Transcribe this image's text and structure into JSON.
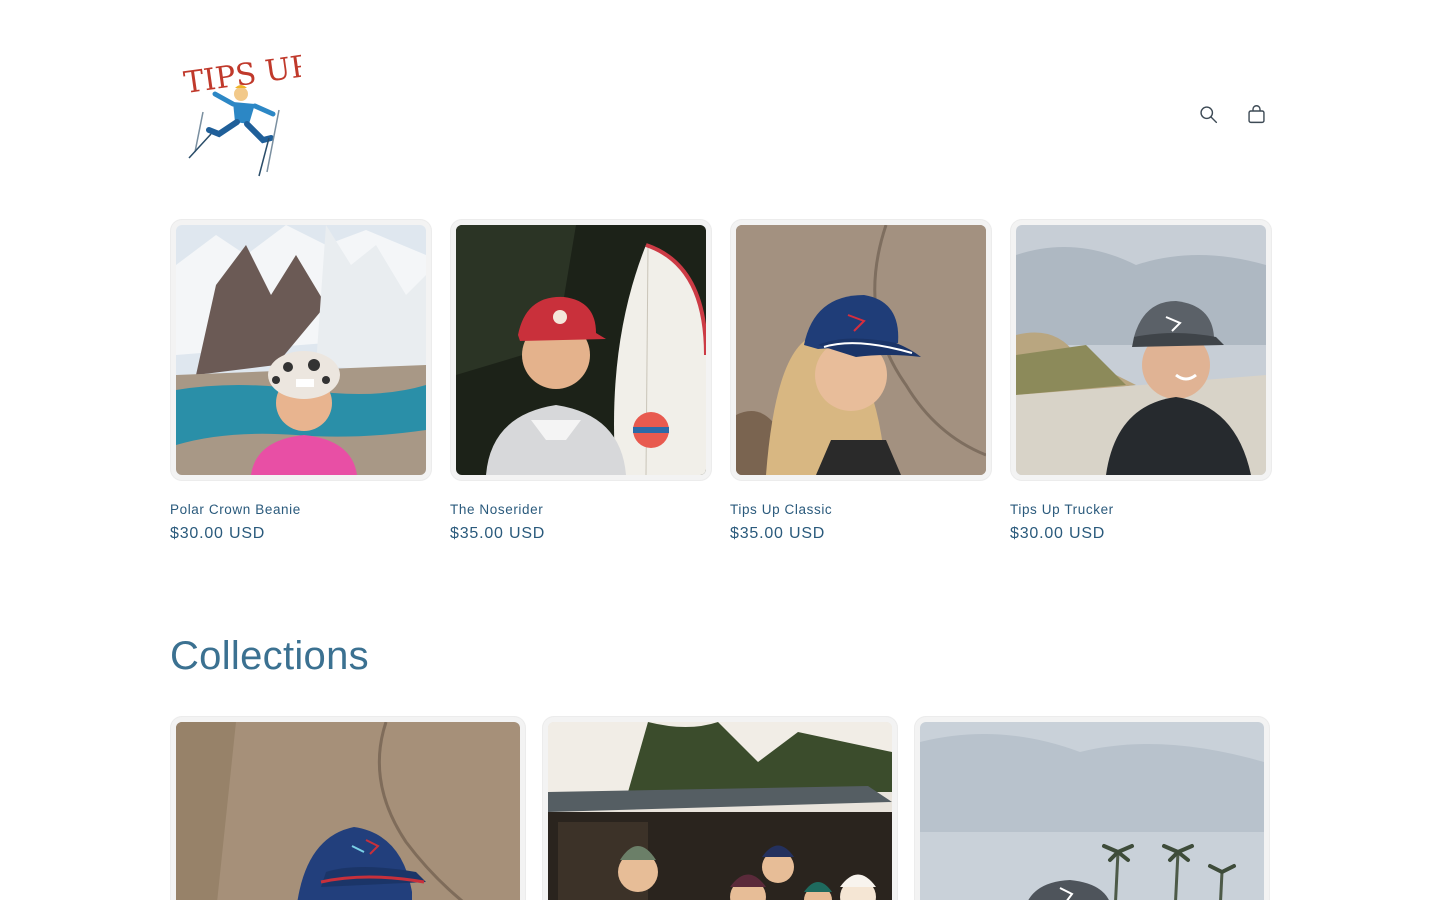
{
  "brand": {
    "logo_text": "TIPS UP!",
    "logo_alt": "Tips Up logo"
  },
  "header": {
    "search_icon": "search-icon",
    "cart_icon": "cart-icon"
  },
  "products": [
    {
      "title": "Polar Crown Beanie",
      "price": "$30.00 USD",
      "image": "woman-beanie-mountain-lake"
    },
    {
      "title": "The Noserider",
      "price": "$35.00 USD",
      "image": "man-red-cap-surfboard"
    },
    {
      "title": "Tips Up Classic",
      "price": "$35.00 USD",
      "image": "woman-navy-cap-rock"
    },
    {
      "title": "Tips Up Trucker",
      "price": "$30.00 USD",
      "image": "man-grey-trucker-beach"
    }
  ],
  "collections": {
    "heading": "Collections",
    "items": [
      {
        "image": "navy-cap-rock-closeup"
      },
      {
        "image": "group-beanies-house"
      },
      {
        "image": "grey-cap-palm-trees"
      }
    ]
  },
  "colors": {
    "text": "#2a5a7c",
    "heading": "#3b7191",
    "card_bg": "#f3f3f3",
    "logo_red": "#c0392b"
  }
}
